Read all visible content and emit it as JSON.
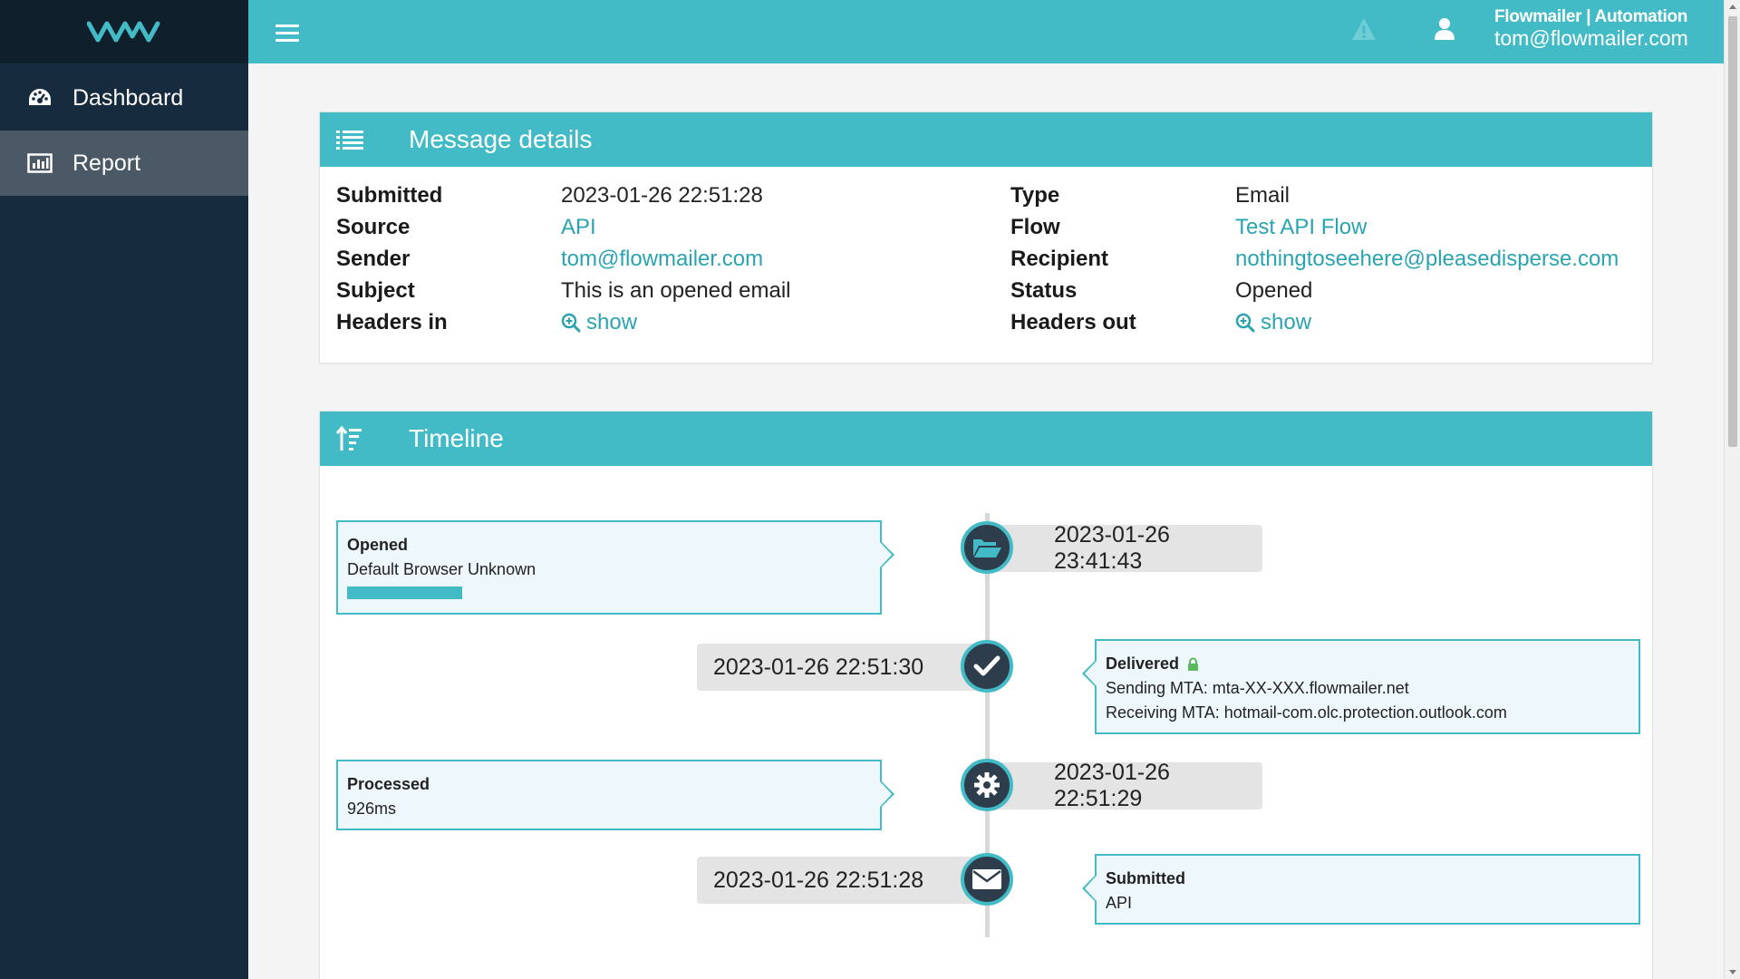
{
  "sidebar": {
    "logo_icon": "flowmailer-logo",
    "items": [
      {
        "label": "Dashboard",
        "icon": "dashboard-gauge-icon",
        "active": false
      },
      {
        "label": "Report",
        "icon": "bar-chart-icon",
        "active": true
      }
    ]
  },
  "topbar": {
    "account_org": "Flowmailer | Automation",
    "account_email": "tom@flowmailer.com"
  },
  "details": {
    "title": "Message details",
    "left": [
      {
        "label": "Submitted",
        "value": "2023-01-26 22:51:28"
      },
      {
        "label": "Source",
        "value": "API"
      },
      {
        "label": "Sender",
        "value": "tom@flowmailer.com"
      },
      {
        "label": "Subject",
        "value": "This is an opened email"
      },
      {
        "label": "Headers in",
        "value": "show"
      }
    ],
    "right": [
      {
        "label": "Type",
        "value": "Email"
      },
      {
        "label": "Flow",
        "value": "Test API Flow"
      },
      {
        "label": "Recipient",
        "value": "nothingtoseehere@pleasedisperse.com"
      },
      {
        "label": "Status",
        "value": "Opened"
      },
      {
        "label": "Headers out",
        "value": "show"
      }
    ]
  },
  "timeline": {
    "title": "Timeline",
    "events": [
      {
        "title": "Opened",
        "lines": [
          "Default Browser Unknown"
        ],
        "time": "2023-01-26 23:41:43",
        "icon": "folder-open-icon"
      },
      {
        "title": "Delivered",
        "lines": [
          "Sending MTA: mta-XX-XXX.flowmailer.net",
          "Receiving MTA: hotmail-com.olc.protection.outlook.com"
        ],
        "time": "2023-01-26 22:51:30",
        "icon": "check-icon"
      },
      {
        "title": "Processed",
        "lines": [
          "926ms"
        ],
        "time": "2023-01-26 22:51:29",
        "icon": "gear-icon"
      },
      {
        "title": "Submitted",
        "lines": [
          "API"
        ],
        "time": "2023-01-26 22:51:28",
        "icon": "envelope-icon"
      }
    ]
  },
  "colors": {
    "accent": "#43bbc6",
    "sidebar": "#162b3d",
    "sidebar_active": "#4b5966",
    "link": "#2aa4b0",
    "node": "#2d3d4c",
    "lock": "#5cb85c"
  }
}
